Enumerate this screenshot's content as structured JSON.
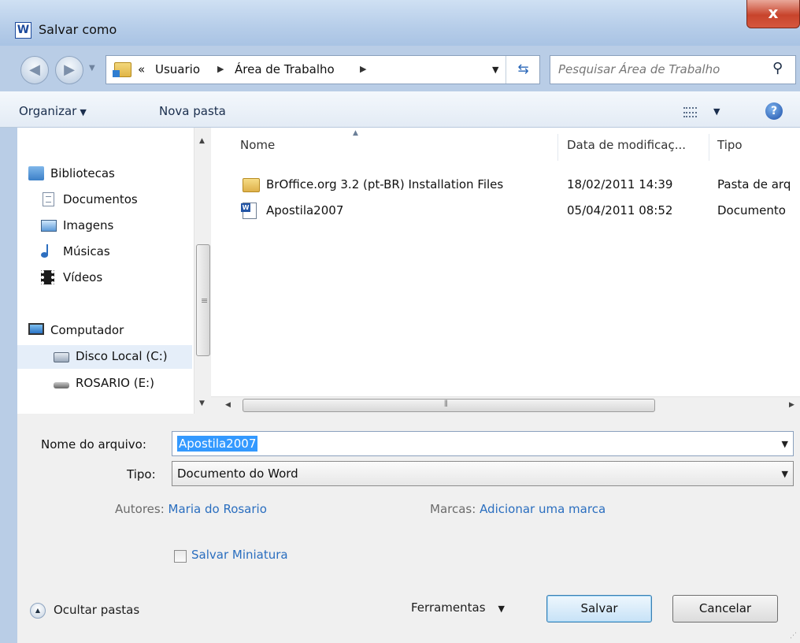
{
  "window": {
    "title": "Salvar como",
    "app_icon_letter": "W",
    "close_glyph": "x"
  },
  "address_bar": {
    "overflow": "«",
    "crumbs": [
      "Usuario",
      "Área de Trabalho"
    ],
    "search_placeholder": "Pesquisar Área de Trabalho"
  },
  "toolbar": {
    "organize": "Organizar",
    "new_folder": "Nova pasta",
    "help": "?"
  },
  "nav_pane": {
    "items": [
      {
        "label": "Bibliotecas",
        "icon": "library-icon"
      },
      {
        "label": "Documentos",
        "icon": "documents-icon"
      },
      {
        "label": "Imagens",
        "icon": "pictures-icon"
      },
      {
        "label": "Músicas",
        "icon": "music-icon"
      },
      {
        "label": "Vídeos",
        "icon": "videos-icon"
      },
      {
        "label": "Computador",
        "icon": "computer-icon"
      },
      {
        "label": "Disco Local (C:)",
        "icon": "local-disk-icon",
        "selected": true
      },
      {
        "label": "ROSARIO (E:)",
        "icon": "usb-drive-icon"
      }
    ]
  },
  "file_list": {
    "columns": [
      "Nome",
      "Data de modificaç...",
      "Tipo"
    ],
    "rows": [
      {
        "name": "BrOffice.org 3.2 (pt-BR) Installation Files",
        "date": "18/02/2011 14:39",
        "type": "Pasta de arq",
        "icon": "folder-icon"
      },
      {
        "name": "Apostila2007",
        "date": "05/04/2011 08:52",
        "type": "Documento",
        "icon": "word-doc-icon"
      }
    ]
  },
  "form": {
    "filename_label": "Nome do arquivo:",
    "filename_value": "Apostila2007",
    "type_label": "Tipo:",
    "type_value": "Documento do Word",
    "authors_label": "Autores:",
    "authors_value": "Maria do Rosario",
    "tags_label": "Marcas:",
    "tags_value": "Adicionar uma marca",
    "thumbnail_label": "Salvar Miniatura",
    "hide_folders": "Ocultar pastas",
    "tools_label": "Ferramentas",
    "save_label": "Salvar",
    "cancel_label": "Cancelar"
  },
  "colors": {
    "accent_link": "#2a6ebf",
    "selection": "#3399ff",
    "close_button": "#c8442c"
  }
}
